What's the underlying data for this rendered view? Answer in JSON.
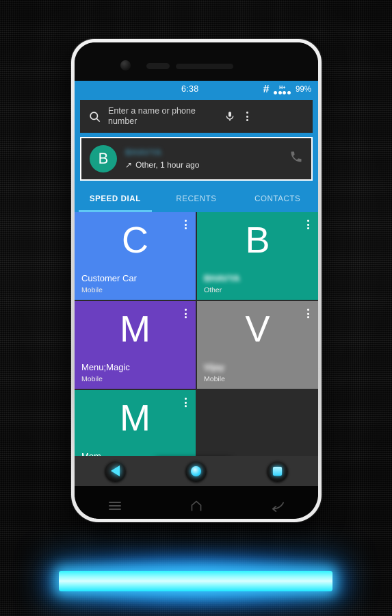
{
  "status_bar": {
    "clock": "6:38",
    "hash_icon": "#",
    "network_label": "H+",
    "signal_dots": 4,
    "battery": "99%"
  },
  "search": {
    "placeholder": "Enter a name or phone number",
    "value": "",
    "search_icon": "search-icon",
    "mic_icon": "microphone-icon",
    "overflow_icon": "overflow-menu-icon"
  },
  "recent_call": {
    "avatar_letter": "B",
    "avatar_color": "#16a085",
    "name": "BHAVYA",
    "direction_icon": "↗",
    "meta": "Other, 1 hour ago",
    "call_icon": "phone-icon"
  },
  "tabs": [
    {
      "label": "SPEED DIAL",
      "active": true
    },
    {
      "label": "RECENTS",
      "active": false
    },
    {
      "label": "CONTACTS",
      "active": false
    }
  ],
  "speed_dial": [
    {
      "letter": "C",
      "name": "Customer Car",
      "sub": "Mobile",
      "color": "#4a86f0",
      "blurred": false
    },
    {
      "letter": "B",
      "name": "BHAVYA",
      "sub": "Other",
      "color": "#0d9e88",
      "blurred": true
    },
    {
      "letter": "M",
      "name": "Menu;Magic",
      "sub": "Mobile",
      "color": "#6b3fc0",
      "blurred": false
    },
    {
      "letter": "V",
      "name": "Vijay",
      "sub": "Mobile",
      "color": "#868686",
      "blurred": true
    },
    {
      "letter": "M",
      "name": "Mom",
      "sub": "",
      "color": "#0d9e88",
      "blurred": false
    }
  ],
  "dialpad_button": {
    "icon": "dialpad-icon",
    "accent_color": "#29c9f7"
  },
  "soft_keys": [
    {
      "name": "back-button",
      "icon": "triangle-left-icon"
    },
    {
      "name": "home-button",
      "icon": "circle-icon"
    },
    {
      "name": "recents-button",
      "icon": "square-icon"
    }
  ],
  "bezel_keys": [
    {
      "name": "menu-key",
      "icon": "hamburger-icon"
    },
    {
      "name": "home-key",
      "icon": "home-outline-icon"
    },
    {
      "name": "back-key",
      "icon": "back-arrow-icon"
    }
  ],
  "theme": {
    "primary_blue": "#1b8fd2",
    "accent_cyan": "#29c9f7",
    "screen_bg": "#2b2b2b",
    "bar_bg": "#2a2a2a"
  }
}
